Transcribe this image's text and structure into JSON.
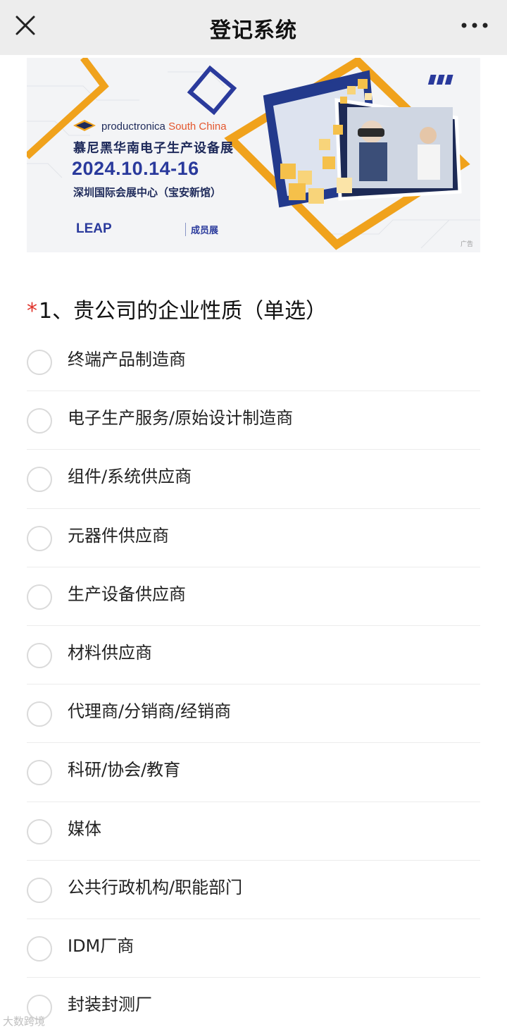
{
  "topbar": {
    "title": "登记系统",
    "close_icon": "close-icon",
    "more_icon": "more-icon"
  },
  "banner": {
    "brand": "productronica",
    "brand_region": "South China",
    "event_zh": "慕尼黑华南电子生产设备展",
    "date": "2024.10.14-16",
    "venue": "深圳国际会展中心（宝安新馆）",
    "leap": "LEAP",
    "member": "成员展",
    "ad_label": "广告",
    "colors": {
      "orange": "#f0a21c",
      "navy": "#1e2a5a",
      "blue": "#2a3a9c"
    }
  },
  "question": {
    "required_mark": "*",
    "text": "1、贵公司的企业性质（单选）",
    "options": [
      {
        "label": "终端产品制造商"
      },
      {
        "label": "电子生产服务/原始设计制造商"
      },
      {
        "label": "组件/系统供应商"
      },
      {
        "label": "元器件供应商"
      },
      {
        "label": "生产设备供应商"
      },
      {
        "label": "材料供应商"
      },
      {
        "label": "代理商/分销商/经销商"
      },
      {
        "label": "科研/协会/教育"
      },
      {
        "label": "媒体"
      },
      {
        "label": "公共行政机构/职能部门"
      },
      {
        "label": "IDM厂商"
      },
      {
        "label": "封装封测厂"
      }
    ]
  },
  "watermark": "大数跨境"
}
